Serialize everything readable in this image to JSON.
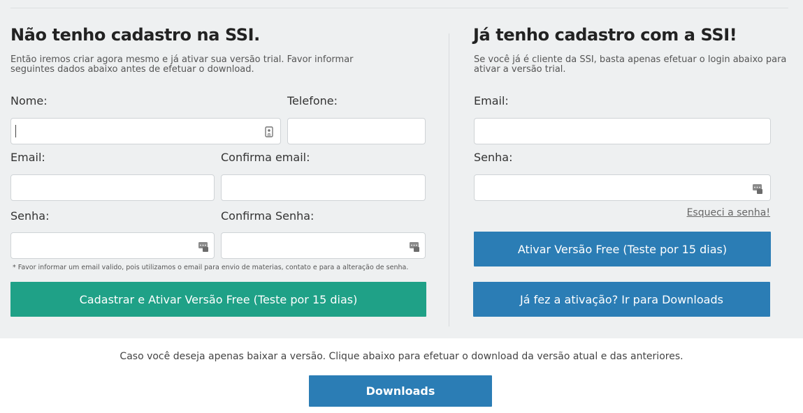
{
  "left": {
    "title": "Não tenho cadastro na SSI.",
    "desc": "Então iremos criar agora mesmo e já ativar sua versão trial. Favor informar seguintes dados abaixo antes de efetuar o download.",
    "labels": {
      "nome": "Nome:",
      "telefone": "Telefone:",
      "email": "Email:",
      "confirma_email": "Confirma email:",
      "senha": "Senha:",
      "confirma_senha": "Confirma Senha:"
    },
    "note": "* Favor informar um email valido, pois utilizamos o email para envio de materias, contato e para a alteração de senha.",
    "submit": "Cadastrar e Ativar Versão Free (Teste por 15 dias)"
  },
  "right": {
    "title": "Já tenho cadastro com a SSI!",
    "desc": "Se você já é cliente da SSI, basta apenas efetuar o login abaixo para ativar a versão trial.",
    "labels": {
      "email": "Email:",
      "senha": "Senha:"
    },
    "forgot": "Esqueci a senha!",
    "activate": "Ativar Versão Free (Teste por 15 dias)",
    "downloads_link": "Já fez a ativação? Ir para Downloads"
  },
  "bottom": {
    "text": "Caso você deseja apenas baixar a versão. Clique abaixo para efetuar o download da versão atual e das anteriores.",
    "button": "Downloads"
  },
  "icons": {
    "contact_card": "contact-card-icon",
    "password_manager": "password-manager-icon"
  },
  "colors": {
    "green_button": "#1fa187",
    "blue_button": "#2b7db5",
    "panel_bg": "#eef0f1"
  }
}
